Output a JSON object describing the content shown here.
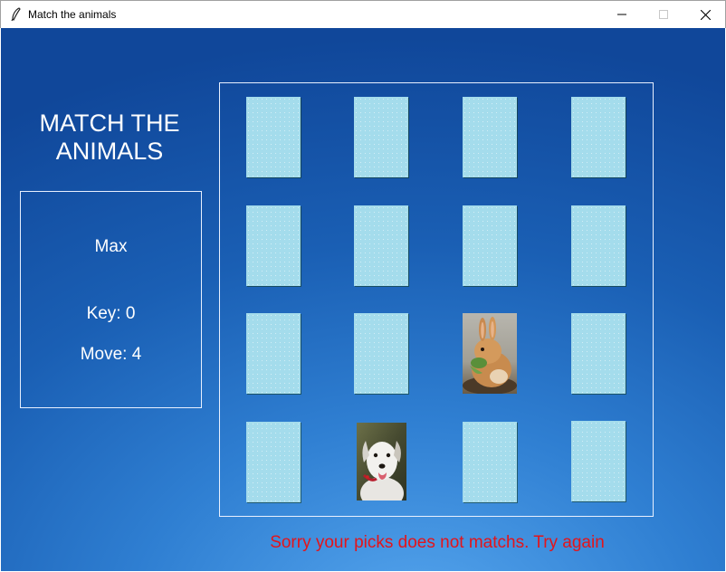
{
  "window": {
    "title": "Match the animals",
    "app_icon": "feather-icon",
    "controls": [
      "minimize-icon",
      "maximize-icon",
      "close-icon"
    ]
  },
  "game": {
    "heading_line1": "MATCH THE",
    "heading_line2": "ANIMALS",
    "player_name": "Max",
    "key_text": "Key: 0",
    "move_text": "Move: 4",
    "status_message": "Sorry your picks does not matchs. Try again"
  },
  "board": {
    "rows": 4,
    "cols": 4,
    "face_up": [
      {
        "row": 2,
        "col": 2,
        "animal": "rabbit"
      },
      {
        "row": 3,
        "col": 1,
        "animal": "dog"
      }
    ]
  },
  "colors": {
    "card_back": "#a4dcec",
    "text": "#ffffff",
    "status_text": "#e4141a",
    "border": "#e8f0ff"
  }
}
